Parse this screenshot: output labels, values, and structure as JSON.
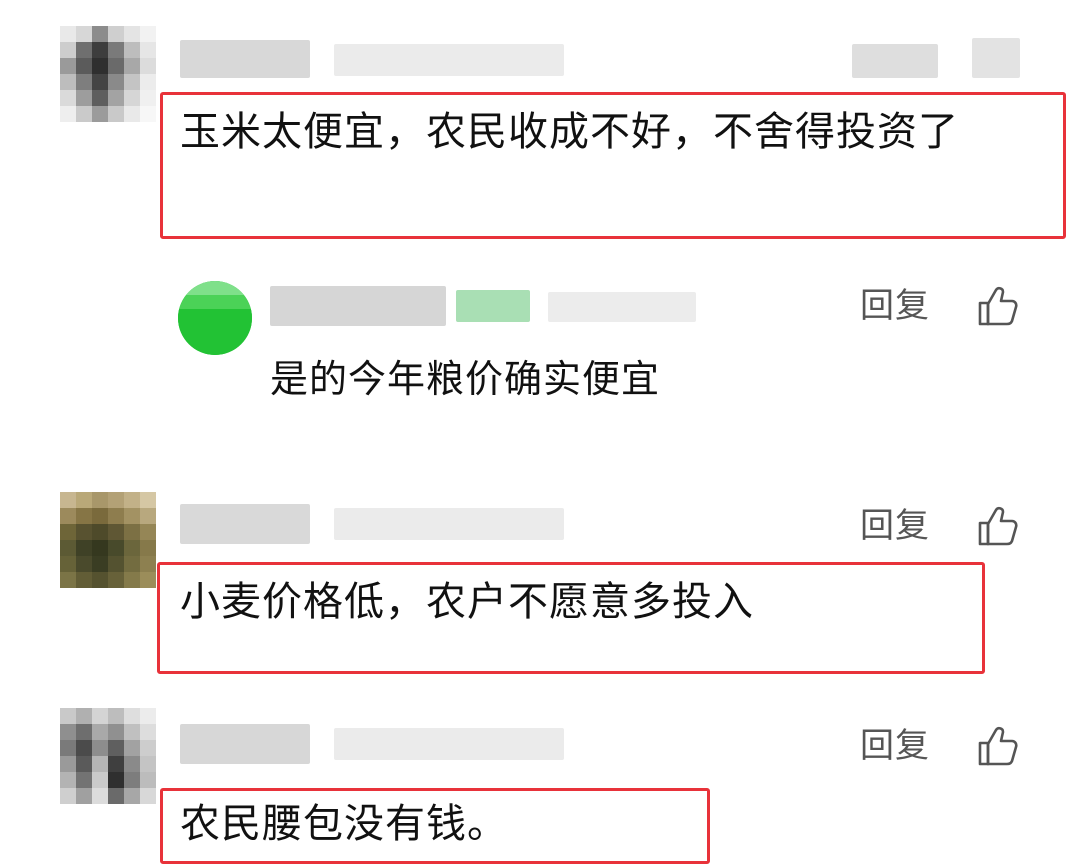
{
  "comments": [
    {
      "text": "玉米太便宜，农民收成不好，不舍得投资了",
      "reply": {
        "text": "是的今年粮价确实便宜",
        "reply_label": "回复"
      },
      "highlight_color": "#e8323a"
    },
    {
      "text": "小麦价格低，农户不愿意多投入",
      "reply_label": "回复",
      "highlight_color": "#e8323a"
    },
    {
      "text": "农民腰包没有钱。",
      "reply_label": "回复",
      "highlight_color": "#e8323a"
    }
  ],
  "icons": {
    "like": "thumbs-up-icon"
  },
  "colors": {
    "highlight": "#e8323a",
    "reply_avatar": "#24c33a",
    "action_text": "#555555"
  }
}
